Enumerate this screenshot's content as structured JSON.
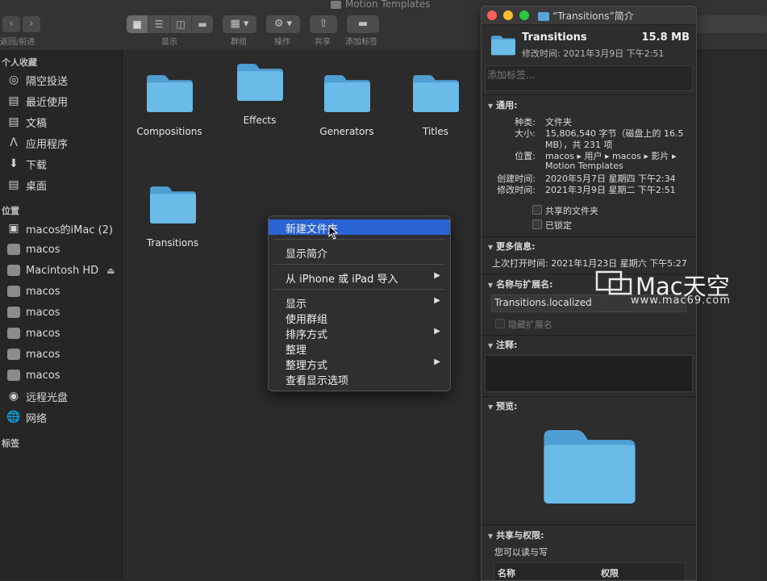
{
  "window": {
    "title": "Motion Templates"
  },
  "toolbar": {
    "back_forward_label": "返回/前进",
    "view_label": "显示",
    "group_label": "群组",
    "action_label": "操作",
    "share_label": "共享",
    "tags_label": "添加标签"
  },
  "sidebar": {
    "favorites_header": "个人收藏",
    "favorites": [
      {
        "label": "隔空投送",
        "icon": "airdrop-icon"
      },
      {
        "label": "最近使用",
        "icon": "recents-icon"
      },
      {
        "label": "文稿",
        "icon": "documents-icon"
      },
      {
        "label": "应用程序",
        "icon": "applications-icon"
      },
      {
        "label": "下载",
        "icon": "downloads-icon"
      },
      {
        "label": "桌面",
        "icon": "desktop-icon"
      }
    ],
    "locations_header": "位置",
    "locations": [
      {
        "label": "macos的iMac (2)",
        "icon": "imac-icon"
      },
      {
        "label": "macos",
        "icon": "disk-icon"
      },
      {
        "label": "Macintosh HD",
        "icon": "disk-icon"
      },
      {
        "label": "macos",
        "icon": "disk-icon"
      },
      {
        "label": "macos",
        "icon": "disk-icon"
      },
      {
        "label": "macos",
        "icon": "disk-icon"
      },
      {
        "label": "macos",
        "icon": "disk-icon"
      },
      {
        "label": "macos",
        "icon": "disk-icon"
      },
      {
        "label": "远程光盘",
        "icon": "remote-disc-icon"
      },
      {
        "label": "网络",
        "icon": "network-icon"
      }
    ],
    "tags_header": "标签"
  },
  "folders": [
    {
      "name": "Compositions"
    },
    {
      "name": "Effects"
    },
    {
      "name": "Generators"
    },
    {
      "name": "Titles"
    },
    {
      "name": "Transitions"
    }
  ],
  "context_menu": {
    "new_folder": "新建文件夹",
    "get_info": "显示简介",
    "import_from_iphone": "从 iPhone 或 iPad 导入",
    "view": "显示",
    "use_groups": "使用群组",
    "sort_by": "排序方式",
    "clean_up": "整理",
    "clean_up_by": "整理方式",
    "show_view_options": "查看显示选项",
    "submenu_arrow": "▶"
  },
  "info_panel": {
    "title": "“Transitions”简介",
    "name": "Transitions",
    "size": "15.8 MB",
    "modified_short": "修改时间:  2021年3月9日 下午2:51",
    "tags_placeholder": "添加标签...",
    "general_header": "通用:",
    "kind_label": "种类:",
    "kind_value": "文件夹",
    "size_label": "大小:",
    "size_value_line1": "15,806,540 字节（磁盘上的 16.5",
    "size_value_line2": "MB），共 231 项",
    "where_label": "位置:",
    "where_value_line1": "macos ▸ 用户 ▸ macos ▸ 影片 ▸",
    "where_value_line2": "Motion Templates",
    "created_label": "创建时间:",
    "created_value": "2020年5月7日 星期四 下午2:34",
    "modified_label": "修改时间:",
    "modified_value": "2021年3月9日 星期二 下午2:51",
    "shared_folder": "共享的文件夹",
    "locked": "已锁定",
    "more_info_header": "更多信息:",
    "last_opened": "上次打开时间: 2021年1月23日 星期六 下午5:27",
    "name_ext_header": "名称与扩展名:",
    "name_ext_value": "Transitions.localized",
    "hide_ext": "隐藏扩展名",
    "comments_header": "注释:",
    "preview_header": "预览:",
    "sharing_header": "共享与权限:",
    "sharing_desc": "您可以读与写",
    "col_name": "名称",
    "col_privilege": "权限"
  },
  "watermark": {
    "brand": "Mac天空",
    "url": "www.mac69.com"
  },
  "colors": {
    "folder_light": "#6bbbe9",
    "folder_dark": "#4f9fd3",
    "menu_highlight": "#2a63d3"
  }
}
